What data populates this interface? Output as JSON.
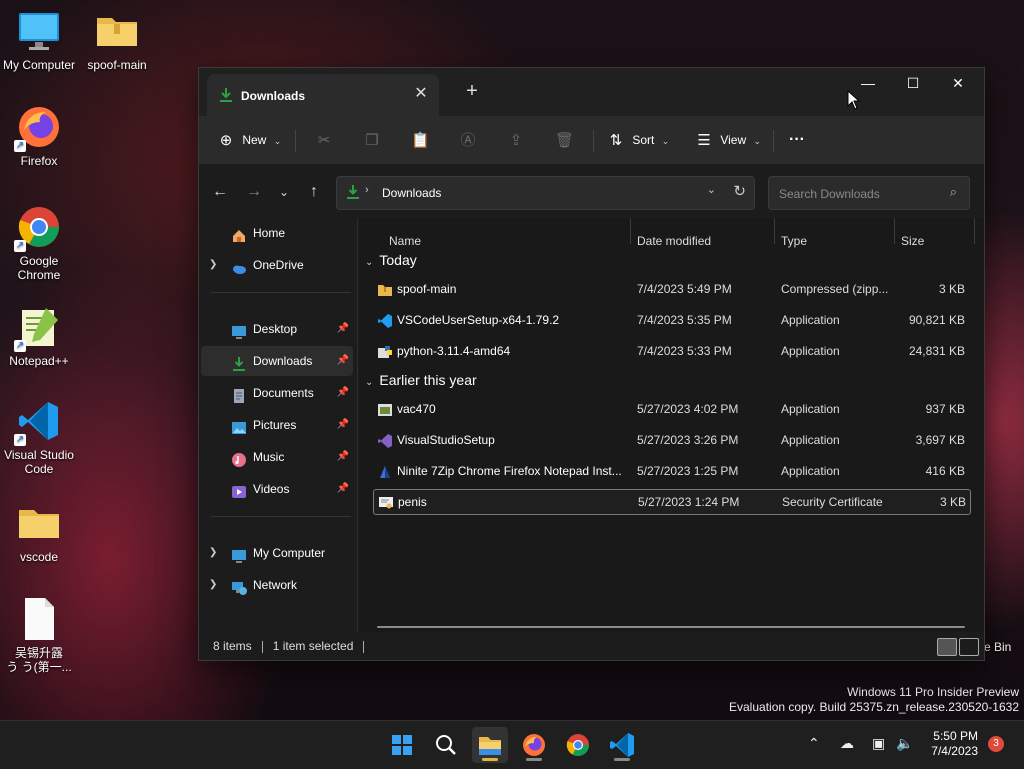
{
  "desktop": {
    "icons": [
      {
        "label": "My Computer",
        "icon": "monitor-icon"
      },
      {
        "label": "spoof-main",
        "icon": "folder-zip-icon"
      },
      {
        "label": "Firefox",
        "icon": "firefox-icon"
      },
      {
        "label": "Google Chrome",
        "icon": "chrome-icon"
      },
      {
        "label": "Notepad++",
        "icon": "notepadpp-icon"
      },
      {
        "label": "Visual Studio Code",
        "icon": "vscode-icon"
      },
      {
        "label": "vscode",
        "icon": "folder-icon"
      },
      {
        "label": "吴锡升露\nう う(第一...",
        "icon": "document-icon"
      },
      {
        "label": "e Bin",
        "icon": "recycle-bin-icon"
      }
    ],
    "watermark": {
      "line1": "Windows 11 Pro Insider Preview",
      "line2": "Evaluation copy. Build 25375.zn_release.230520-1632"
    }
  },
  "window": {
    "tab_title": "Downloads",
    "new_tab": "+",
    "controls": {
      "minimize": "—",
      "maximize": "☐",
      "close": "✕"
    }
  },
  "toolbar": {
    "new_label": "New",
    "sort_label": "Sort",
    "view_label": "View",
    "more_label": "···"
  },
  "address": {
    "path": "Downloads",
    "search_placeholder": "Search Downloads"
  },
  "sidebar": {
    "items": [
      {
        "label": "Home",
        "icon": "home-icon",
        "expandable": false,
        "pinned": false
      },
      {
        "label": "OneDrive",
        "icon": "cloud-icon",
        "expandable": true,
        "pinned": false
      },
      {
        "label": "Desktop",
        "icon": "desktop-icon",
        "expandable": false,
        "pinned": true
      },
      {
        "label": "Downloads",
        "icon": "download-icon",
        "expandable": false,
        "pinned": true
      },
      {
        "label": "Documents",
        "icon": "documents-icon",
        "expandable": false,
        "pinned": true
      },
      {
        "label": "Pictures",
        "icon": "pictures-icon",
        "expandable": false,
        "pinned": true
      },
      {
        "label": "Music",
        "icon": "music-icon",
        "expandable": false,
        "pinned": true
      },
      {
        "label": "Videos",
        "icon": "videos-icon",
        "expandable": false,
        "pinned": true
      },
      {
        "label": "My Computer",
        "icon": "monitor-icon",
        "expandable": true,
        "pinned": false
      },
      {
        "label": "Network",
        "icon": "network-icon",
        "expandable": true,
        "pinned": false
      }
    ]
  },
  "columns": {
    "name": "Name",
    "date": "Date modified",
    "type": "Type",
    "size": "Size"
  },
  "groups": [
    {
      "title": "Today",
      "files": [
        {
          "name": "spoof-main",
          "date": "7/4/2023 5:49 PM",
          "type": "Compressed (zipp...",
          "size": "3 KB",
          "icon": "zip-folder-icon"
        },
        {
          "name": "VSCodeUserSetup-x64-1.79.2",
          "date": "7/4/2023 5:35 PM",
          "type": "Application",
          "size": "90,821 KB",
          "icon": "vscode-icon"
        },
        {
          "name": "python-3.11.4-amd64",
          "date": "7/4/2023 5:33 PM",
          "type": "Application",
          "size": "24,831 KB",
          "icon": "python-icon"
        }
      ]
    },
    {
      "title": "Earlier this year",
      "files": [
        {
          "name": "vac470",
          "date": "5/27/2023 4:02 PM",
          "type": "Application",
          "size": "937 KB",
          "icon": "app-icon"
        },
        {
          "name": "VisualStudioSetup",
          "date": "5/27/2023 3:26 PM",
          "type": "Application",
          "size": "3,697 KB",
          "icon": "visualstudio-icon"
        },
        {
          "name": "Ninite 7Zip Chrome Firefox Notepad Inst...",
          "date": "5/27/2023 1:25 PM",
          "type": "Application",
          "size": "416 KB",
          "icon": "ninite-icon"
        },
        {
          "name": "penis",
          "date": "5/27/2023 1:24 PM",
          "type": "Security Certificate",
          "size": "3 KB",
          "icon": "certificate-icon",
          "selected": true
        }
      ]
    }
  ],
  "status": {
    "items": "8 items",
    "selected": "1 item selected"
  },
  "taskbar": {
    "apps": [
      "start-icon",
      "search-icon",
      "file-explorer-icon",
      "firefox-icon",
      "chrome-icon",
      "vscode-icon"
    ],
    "time": "5:50 PM",
    "date": "7/4/2023",
    "notification_count": "3"
  },
  "colors": {
    "accent": "#2ea043",
    "folder": "#e8b84a",
    "selection_border": "#7a7a7a"
  }
}
